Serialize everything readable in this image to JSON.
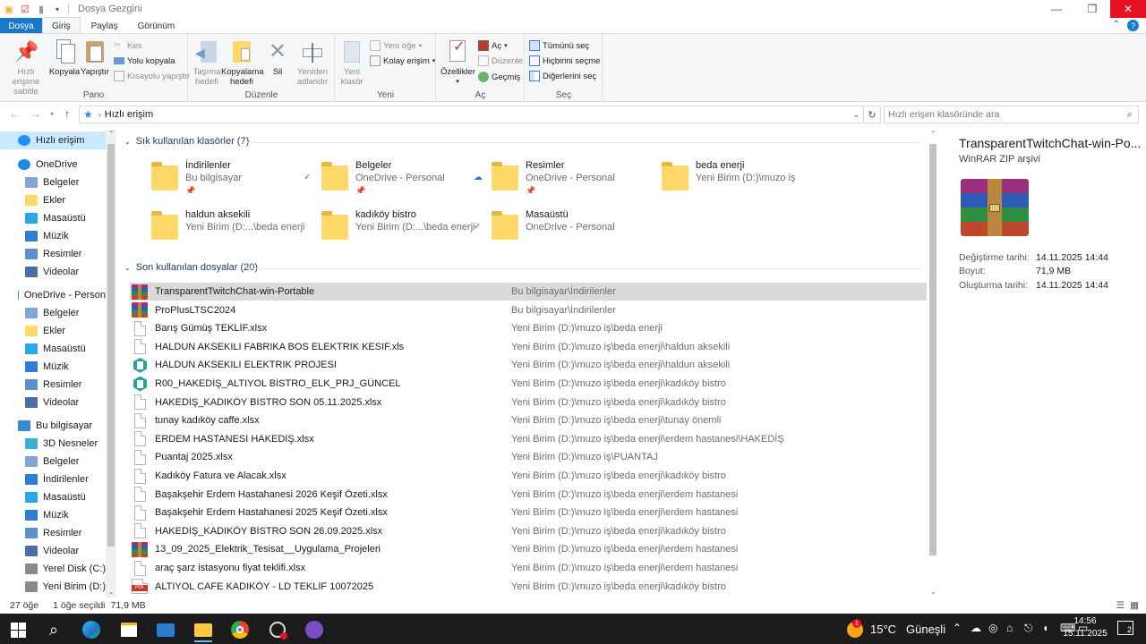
{
  "window": {
    "title": "Dosya Gezgini",
    "minimize_glyph": "—",
    "maximize_glyph": "❐",
    "close_glyph": "✕"
  },
  "tabs": {
    "file": "Dosya",
    "home": "Giriş",
    "share": "Paylaş",
    "view": "Görünüm"
  },
  "ribbon": {
    "pano": {
      "label": "Pano",
      "pin": "Hızlı erişime sabitle",
      "copy": "Kopyala",
      "paste": "Yapıştır",
      "cut": "Kes",
      "copy_path": "Yolu kopyala",
      "paste_shortcut": "Kısayolu yapıştır"
    },
    "duzenle": {
      "label": "Düzenle",
      "move_to": "Taşıma hedefi",
      "copy_to": "Kopyalama hedefi",
      "delete": "Sil",
      "rename": "Yeniden adlandır"
    },
    "yeni": {
      "label": "Yeni",
      "new_folder": "Yeni klasör",
      "new_item": "Yeni öğe",
      "easy_access": "Kolay erişim"
    },
    "ac": {
      "label": "Aç",
      "properties": "Özellikler",
      "open": "Aç",
      "edit": "Düzenle",
      "history": "Geçmiş"
    },
    "sec": {
      "label": "Seç",
      "select_all": "Tümünü seç",
      "select_none": "Hiçbirini seçme",
      "invert": "Diğerlerini seç"
    }
  },
  "address": {
    "path": "Hızlı erişim",
    "search_placeholder": "Hızlı erişim klasöründe ara"
  },
  "nav": [
    {
      "label": "Hızlı erişim",
      "icon": "star-icon",
      "color": "#1e90ff"
    },
    {
      "label": "OneDrive",
      "icon": "cloud-icon",
      "color": "#1e88e5"
    },
    {
      "label": "Belgeler",
      "icon": "documents-icon",
      "color": "#7fa6d6"
    },
    {
      "label": "Ekler",
      "icon": "folder-icon",
      "color": "#ffd869"
    },
    {
      "label": "Masaüstü",
      "icon": "desktop-icon",
      "color": "#2aa7e8"
    },
    {
      "label": "Müzik",
      "icon": "music-icon",
      "color": "#2d7dd2"
    },
    {
      "label": "Resimler",
      "icon": "pictures-icon",
      "color": "#5b8fc9"
    },
    {
      "label": "Videolar",
      "icon": "videos-icon",
      "color": "#4a6fa5"
    },
    {
      "label": "OneDrive - Person",
      "icon": "cloud-icon",
      "color": "#1e88e5"
    },
    {
      "label": "Belgeler",
      "icon": "documents-icon",
      "color": "#7fa6d6"
    },
    {
      "label": "Ekler",
      "icon": "folder-icon",
      "color": "#ffd869"
    },
    {
      "label": "Masaüstü",
      "icon": "desktop-icon",
      "color": "#2aa7e8"
    },
    {
      "label": "Müzik",
      "icon": "music-icon",
      "color": "#2d7dd2"
    },
    {
      "label": "Resimler",
      "icon": "pictures-icon",
      "color": "#5b8fc9"
    },
    {
      "label": "Videolar",
      "icon": "videos-icon",
      "color": "#4a6fa5"
    },
    {
      "label": "Bu bilgisayar",
      "icon": "computer-icon",
      "color": "#3a8ad1"
    },
    {
      "label": "3D Nesneler",
      "icon": "3d-objects-icon",
      "color": "#3ab0d8"
    },
    {
      "label": "Belgeler",
      "icon": "documents-icon",
      "color": "#7fa6d6"
    },
    {
      "label": "İndirilenler",
      "icon": "downloads-icon",
      "color": "#2d7dd2"
    },
    {
      "label": "Masaüstü",
      "icon": "desktop-icon",
      "color": "#2aa7e8"
    },
    {
      "label": "Müzik",
      "icon": "music-icon",
      "color": "#2d7dd2"
    },
    {
      "label": "Resimler",
      "icon": "pictures-icon",
      "color": "#5b8fc9"
    },
    {
      "label": "Videolar",
      "icon": "videos-icon",
      "color": "#4a6fa5"
    },
    {
      "label": "Yerel Disk (C:)",
      "icon": "drive-icon",
      "color": "#8a8a8a"
    },
    {
      "label": "Yeni Birim (D:)",
      "icon": "drive-icon",
      "color": "#8a8a8a"
    }
  ],
  "frequent": {
    "header": "Sık kullanılan klasörler (7)",
    "items": [
      {
        "name": "İndirilenler",
        "sub": "Bu bilgisayar",
        "pinned": true,
        "status": ""
      },
      {
        "name": "Belgeler",
        "sub": "OneDrive - Personal",
        "pinned": true,
        "status": "✓"
      },
      {
        "name": "Resimler",
        "sub": "OneDrive - Personal",
        "pinned": true,
        "status": "☁"
      },
      {
        "name": "beda enerji",
        "sub": "Yeni Birim (D:)\\muzo iş",
        "pinned": false,
        "status": ""
      },
      {
        "name": "haldun aksekili",
        "sub": "Yeni Birim (D:...\\beda enerji",
        "pinned": false,
        "status": ""
      },
      {
        "name": "kadıköy bistro",
        "sub": "Yeni Birim (D:...\\beda enerji",
        "pinned": false,
        "status": ""
      },
      {
        "name": "Masaüstü",
        "sub": "OneDrive - Personal",
        "pinned": false,
        "status": "✓"
      }
    ]
  },
  "recent": {
    "header": "Son kullanılan dosyalar (20)",
    "items": [
      {
        "name": "TransparentTwitchChat-win-Portable",
        "path": "Bu bilgisayar\\İndirilenler",
        "icon": "rar"
      },
      {
        "name": "ProPlusLTSC2024",
        "path": "Bu bilgisayar\\İndirilenler",
        "icon": "rar"
      },
      {
        "name": "Barış Gümüş TEKLİF.xlsx",
        "path": "Yeni Birim (D:)\\muzo iş\\beda enerji",
        "icon": "doc"
      },
      {
        "name": "HALDUN AKSEKILI FABRIKA BOS ELEKTRIK KESIF.xls",
        "path": "Yeni Birim (D:)\\muzo iş\\beda enerji\\haldun aksekili",
        "icon": "doc"
      },
      {
        "name": "HALDUN AKSEKILI ELEKTRIK PROJESI",
        "path": "Yeni Birim (D:)\\muzo iş\\beda enerji\\haldun aksekili",
        "icon": "cad"
      },
      {
        "name": "R00_HAKEDİŞ_ALTIYOL BİSTRO_ELK_PRJ_GÜNCEL",
        "path": "Yeni Birim (D:)\\muzo iş\\beda enerji\\kadıköy bistro",
        "icon": "cad"
      },
      {
        "name": "HAKEDİŞ_KADIKÖY BİSTRO SON 05.11.2025.xlsx",
        "path": "Yeni Birim (D:)\\muzo iş\\beda enerji\\kadıköy bistro",
        "icon": "doc"
      },
      {
        "name": "tunay kadıköy caffe.xlsx",
        "path": "Yeni Birim (D:)\\muzo iş\\beda enerji\\tunay önemli",
        "icon": "doc"
      },
      {
        "name": "ERDEM HASTANESİ HAKEDİŞ.xlsx",
        "path": "Yeni Birim (D:)\\muzo iş\\beda enerji\\erdem hastanesi\\HAKEDİŞ",
        "icon": "doc"
      },
      {
        "name": "Puantaj 2025.xlsx",
        "path": "Yeni Birim (D:)\\muzo iş\\PUANTAJ",
        "icon": "doc"
      },
      {
        "name": "Kadıköy Fatura ve Alacak.xlsx",
        "path": "Yeni Birim (D:)\\muzo iş\\beda enerji\\kadıköy bistro",
        "icon": "doc"
      },
      {
        "name": "Başakşehir Erdem Hastahanesi 2026 Keşif Özeti.xlsx",
        "path": "Yeni Birim (D:)\\muzo iş\\beda enerji\\erdem hastanesi",
        "icon": "doc"
      },
      {
        "name": "Başakşehir Erdem Hastahanesi 2025 Keşif Özeti.xlsx",
        "path": "Yeni Birim (D:)\\muzo iş\\beda enerji\\erdem hastanesi",
        "icon": "doc"
      },
      {
        "name": "HAKEDİŞ_KADIKÖY BİSTRO SON 26.09.2025.xlsx",
        "path": "Yeni Birim (D:)\\muzo iş\\beda enerji\\kadıköy bistro",
        "icon": "doc"
      },
      {
        "name": "13_09_2025_Elektrik_Tesisat__Uygulama_Projeleri",
        "path": "Yeni Birim (D:)\\muzo iş\\beda enerji\\erdem hastanesi",
        "icon": "rar"
      },
      {
        "name": "araç şarz istasyonu fiyat teklifi.xlsx",
        "path": "Yeni Birim (D:)\\muzo iş\\beda enerji\\erdem hastanesi",
        "icon": "doc"
      },
      {
        "name": "ALTIYOL CAFE KADIKÖY - LD TEKLİF 10072025",
        "path": "Yeni Birim (D:)\\muzo iş\\beda enerji\\kadıköy bistro",
        "icon": "pdf"
      }
    ]
  },
  "preview": {
    "name": "TransparentTwitchChat-win-Po...",
    "type": "WinRAR ZIP arşivi",
    "modified_label": "Değiştirme tarihi:",
    "modified": "14.11.2025 14:44",
    "size_label": "Boyut:",
    "size": "71,9 MB",
    "created_label": "Oluşturma tarihi:",
    "created": "14.11.2025 14:44"
  },
  "status": {
    "count": "27 öğe",
    "selected": "1 öğe seçildi",
    "size": "71,9 MB"
  },
  "taskbar": {
    "weather_temp": "15°C",
    "weather_text": "Güneşli",
    "weather_badge": "1",
    "time": "14:56",
    "date": "15.11.2025",
    "notif_count": "2"
  },
  "colors": {
    "accent": "#1979ca",
    "selection": "#cce8ff",
    "row_selected": "#d9d9d9",
    "close": "#e81123",
    "taskbar": "#1c1c1c"
  }
}
